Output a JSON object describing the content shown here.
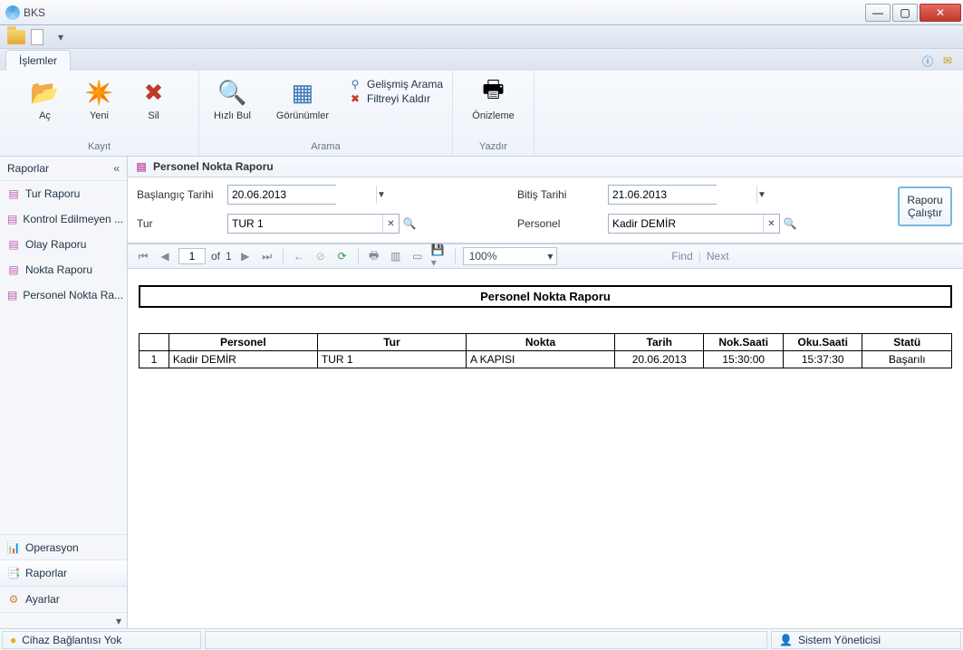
{
  "window": {
    "title": "BKS"
  },
  "tabs": {
    "active": "İşlemler"
  },
  "ribbon": {
    "groups": [
      {
        "label": "Kayıt",
        "buttons": [
          {
            "key": "open",
            "label": "Aç"
          },
          {
            "key": "new",
            "label": "Yeni"
          },
          {
            "key": "delete",
            "label": "Sil"
          }
        ]
      },
      {
        "label": "Arama",
        "buttons": [
          {
            "key": "quickfind",
            "label": "Hızlı Bul"
          },
          {
            "key": "views",
            "label": "Görünümler"
          }
        ],
        "small": [
          {
            "key": "advsearch",
            "label": "Gelişmiş Arama"
          },
          {
            "key": "clearfilter",
            "label": "Filtreyi Kaldır"
          }
        ]
      },
      {
        "label": "Yazdır",
        "buttons": [
          {
            "key": "preview",
            "label": "Önizleme"
          }
        ]
      }
    ]
  },
  "sidebar": {
    "title": "Raporlar",
    "items": [
      {
        "label": "Tur Raporu"
      },
      {
        "label": "Kontrol Edilmeyen ..."
      },
      {
        "label": "Olay Raporu"
      },
      {
        "label": "Nokta Raporu"
      },
      {
        "label": "Personel Nokta Ra..."
      }
    ],
    "sections": [
      {
        "label": "Operasyon"
      },
      {
        "label": "Raporlar"
      },
      {
        "label": "Ayarlar"
      }
    ]
  },
  "main": {
    "title": "Personel Nokta Raporu"
  },
  "filters": {
    "start_label": "Başlangıç Tarihi",
    "end_label": "Bitiş Tarihi",
    "tur_label": "Tur",
    "personel_label": "Personel",
    "start_value": "20.06.2013",
    "end_value": "21.06.2013",
    "tur_value": "TUR 1",
    "personel_value": "Kadir DEMİR",
    "run_label": "Raporu Çalıştır"
  },
  "report_toolbar": {
    "page": "1",
    "of_label": "of",
    "total_pages": "1",
    "zoom": "100%",
    "find_label": "Find",
    "next_label": "Next"
  },
  "report": {
    "title": "Personel Nokta Raporu",
    "columns": [
      "",
      "Personel",
      "Tur",
      "Nokta",
      "Tarih",
      "Nok.Saati",
      "Oku.Saati",
      "Statü"
    ],
    "rows": [
      {
        "idx": "1",
        "personel": "Kadir DEMİR",
        "tur": "TUR 1",
        "nokta": "A KAPISI",
        "tarih": "20.06.2013",
        "noksaati": "15:30:00",
        "okusaati": "15:37:30",
        "statu": "Başarılı"
      }
    ]
  },
  "statusbar": {
    "connection": "Cihaz Bağlantısı Yok",
    "user": "Sistem Yöneticisi"
  }
}
